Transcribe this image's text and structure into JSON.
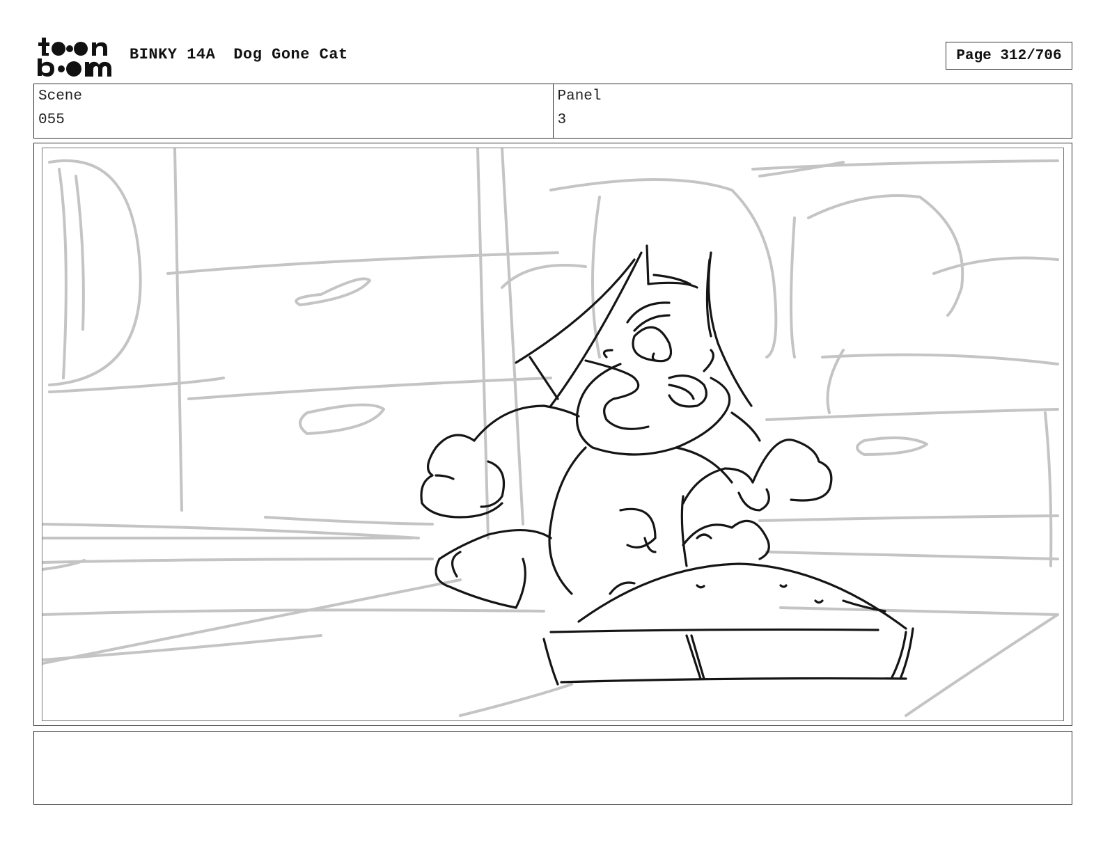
{
  "header": {
    "show_name": "BINKY 14A",
    "episode_title": "Dog Gone Cat",
    "page_label": "Page 312/706"
  },
  "scene": {
    "label": "Scene",
    "value": "055"
  },
  "panel": {
    "label": "Panel",
    "value": "3"
  },
  "notes": {
    "text": ""
  }
}
